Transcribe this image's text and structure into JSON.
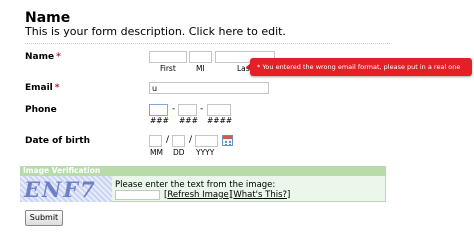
{
  "form": {
    "title": "Name",
    "description": "This is your form description. Click here to edit."
  },
  "fields": {
    "name": {
      "label": "Name",
      "required_mark": "*",
      "first_value": "",
      "middle_value": "",
      "last_value": "",
      "first_sub": "First",
      "middle_sub": "MI",
      "last_sub": "Last"
    },
    "email": {
      "label": "Email",
      "required_mark": "*",
      "value": "u"
    },
    "phone": {
      "label": "Phone",
      "area_value": "",
      "prefix_value": "",
      "line_value": "",
      "area_sub": "###",
      "prefix_sub": "###",
      "line_sub": "####",
      "separator": "-"
    },
    "dob": {
      "label": "Date of birth",
      "mm_value": "",
      "dd_value": "",
      "yyyy_value": "",
      "mm_sub": "MM",
      "dd_sub": "DD",
      "yyyy_sub": "YYYY",
      "separator": "/",
      "calendar_icon": "calendar-icon"
    }
  },
  "error": {
    "message": "* You entered the wrong email format, please put in a real one",
    "color": "#e41f27"
  },
  "verification": {
    "header": "Image Verification",
    "captcha_text": "ENF7",
    "instruction": "Please enter the text from the image:",
    "input_value": "",
    "refresh_label": "Refresh Image",
    "whats_this_label": "What's This?",
    "header_color": "#b7dcaa"
  },
  "submit": {
    "label": "Submit"
  }
}
